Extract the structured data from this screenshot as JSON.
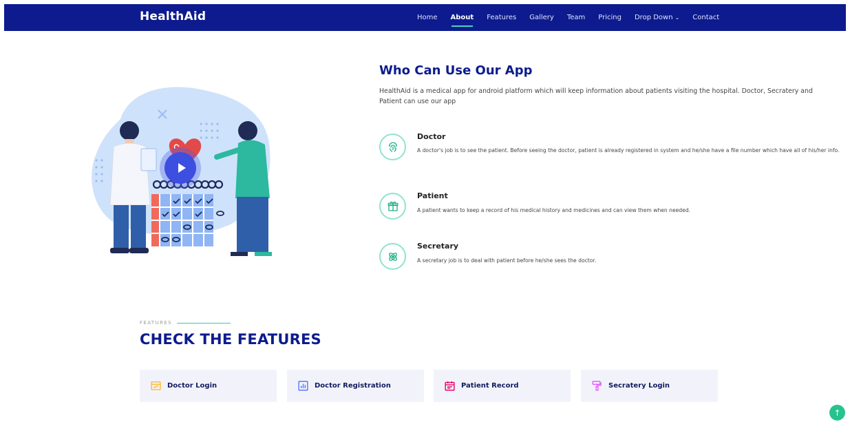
{
  "header": {
    "logo": "HealthAid",
    "nav": [
      {
        "label": "Home"
      },
      {
        "label": "About"
      },
      {
        "label": "Features"
      },
      {
        "label": "Gallery"
      },
      {
        "label": "Team"
      },
      {
        "label": "Pricing"
      },
      {
        "label": "Drop Down"
      },
      {
        "label": "Contact"
      }
    ],
    "active_nav": "About"
  },
  "about": {
    "title": "Who Can Use Our App",
    "description": "HealthAid is a medical app for android platform which will keep information about patients visiting the hospital. Doctor, Secratery and Patient can use our app",
    "roles": [
      {
        "icon": "fingerprint-icon",
        "title": "Doctor",
        "description": "A doctor's job is to see the patient. Before seeing the doctor, patient is already registered in system and he/she have a file number which have all of his/her info."
      },
      {
        "icon": "gift-icon",
        "title": "Patient",
        "description": "A patient wants to keep a record of his medical history and medicines and can view them when needed."
      },
      {
        "icon": "atom-icon",
        "title": "Secretary",
        "description": "A secretary job is to deal with patient before he/she sees the doctor."
      }
    ]
  },
  "features": {
    "kicker": "FEATURES",
    "title": "CHECK THE FEATURES",
    "cards": [
      {
        "icon": "store-icon",
        "label": "Doctor Login",
        "color": "#ffbb2c"
      },
      {
        "icon": "bar-chart-icon",
        "label": "Doctor Registration",
        "color": "#5578ff"
      },
      {
        "icon": "calendar-icon",
        "label": "Patient Record",
        "color": "#e80368"
      },
      {
        "icon": "paint-roller-icon",
        "label": "Secratery Login",
        "color": "#e361ff"
      }
    ]
  },
  "colors": {
    "primary": "#0d1b8e",
    "accent": "#27c38f",
    "icon_ring": "#8fe3cf"
  }
}
